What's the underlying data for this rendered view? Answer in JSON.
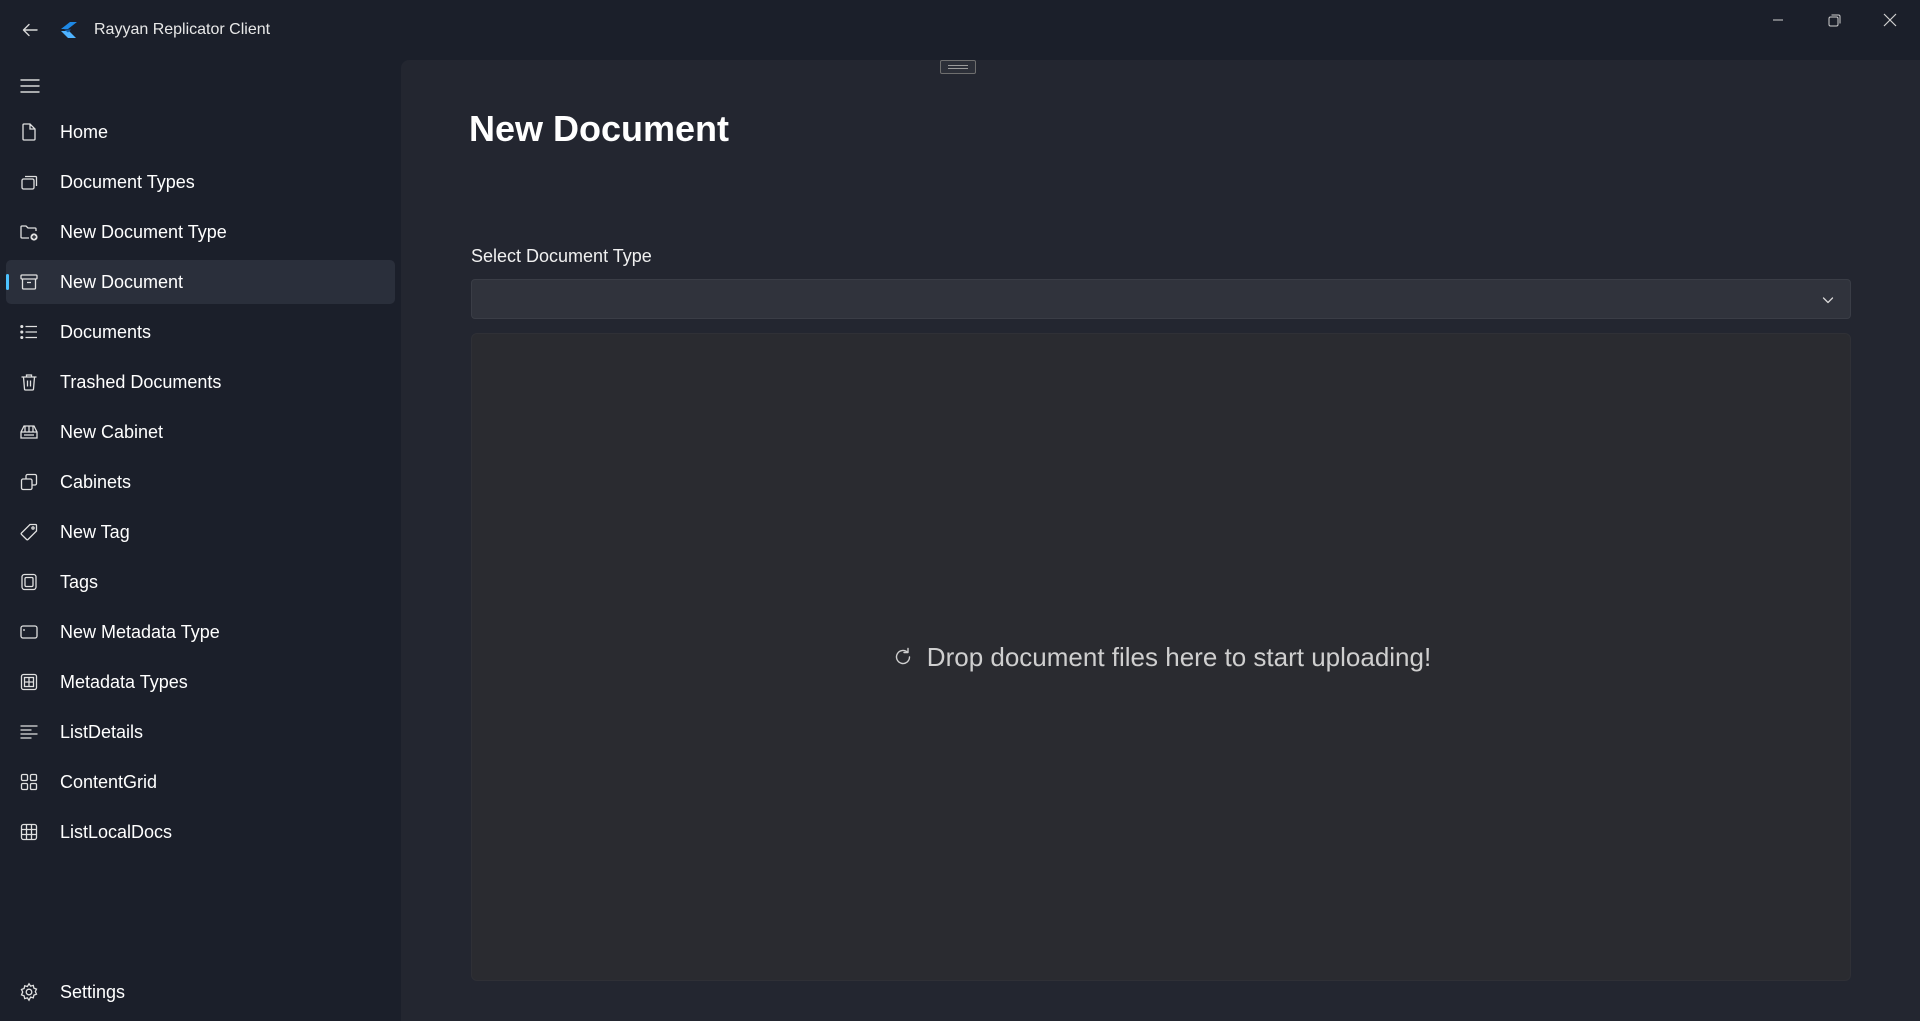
{
  "window": {
    "title": "Rayyan Replicator Client"
  },
  "sidebar": {
    "items": [
      {
        "label": "Home",
        "icon": "document-icon"
      },
      {
        "label": "Document Types",
        "icon": "stacked-docs-icon"
      },
      {
        "label": "New Document Type",
        "icon": "folder-add-icon"
      },
      {
        "label": "New Document",
        "icon": "archive-box-icon"
      },
      {
        "label": "Documents",
        "icon": "bulleted-list-icon"
      },
      {
        "label": "Trashed Documents",
        "icon": "trash-icon"
      },
      {
        "label": "New Cabinet",
        "icon": "cabinet-icon"
      },
      {
        "label": "Cabinets",
        "icon": "copy-windows-icon"
      },
      {
        "label": "New Tag",
        "icon": "tag-icon"
      },
      {
        "label": "Tags",
        "icon": "tag-square-icon"
      },
      {
        "label": "New Metadata Type",
        "icon": "rounded-rect-icon"
      },
      {
        "label": "Metadata Types",
        "icon": "table-icon"
      },
      {
        "label": "ListDetails",
        "icon": "lines-icon"
      },
      {
        "label": "ContentGrid",
        "icon": "grid-icon"
      },
      {
        "label": "ListLocalDocs",
        "icon": "spreadsheet-icon"
      }
    ],
    "active_index": 3,
    "settings_label": "Settings"
  },
  "main": {
    "page_title": "New Document",
    "select_label": "Select Document Type",
    "select_value": "",
    "drop_text": "Drop document files here to start uploading!"
  },
  "colors": {
    "accent": "#4cc2ff",
    "logo": "#1e88e5"
  }
}
